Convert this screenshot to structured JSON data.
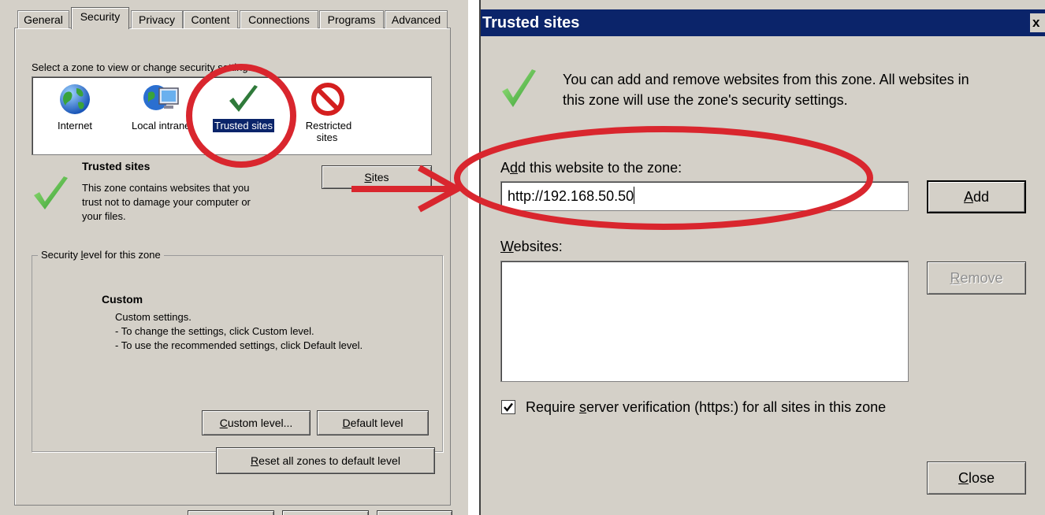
{
  "left_dialog": {
    "tabs": [
      {
        "label": "General"
      },
      {
        "label": "Security"
      },
      {
        "label": "Privacy"
      },
      {
        "label": "Content"
      },
      {
        "label": "Connections"
      },
      {
        "label": "Programs"
      },
      {
        "label": "Advanced"
      }
    ],
    "active_tab": "Security",
    "zone_prompt": "Select a zone to view or change security settings.",
    "zones": [
      {
        "label": "Internet",
        "icon": "globe-icon"
      },
      {
        "label": "Local intranet",
        "icon": "intranet-icon"
      },
      {
        "label": "Trusted sites",
        "icon": "checkmark-icon"
      },
      {
        "label": "Restricted sites",
        "label_line1": "Restricted",
        "label_line2": "sites",
        "icon": "restricted-icon"
      }
    ],
    "selected_zone": "Trusted sites",
    "zone_info": {
      "title": "Trusted sites",
      "line1": "This zone contains websites that you",
      "line2": "trust not to damage your computer or",
      "line3": "your files."
    },
    "sites_button": {
      "pre": "",
      "accel": "S",
      "post": "ites"
    },
    "security_level": {
      "legend_pre": "Security ",
      "legend_accel": "l",
      "legend_post": "evel for this zone",
      "level_name": "Custom",
      "line1": "Custom settings.",
      "line2": "- To change the settings, click Custom level.",
      "line3": "- To use the recommended settings, click Default level."
    },
    "custom_level_button": {
      "accel": "C",
      "post": "ustom level..."
    },
    "default_level_button": {
      "accel": "D",
      "post": "efault level"
    },
    "reset_button": {
      "accel": "R",
      "post": "eset all zones to default level"
    }
  },
  "right_dialog": {
    "title": "Trusted sites",
    "close_glyph": "x",
    "description_line1": "You can add and remove websites from this zone. All websites in",
    "description_line2": "this zone will use the zone's security settings.",
    "add_label": {
      "pre": "A",
      "accel": "d",
      "post": "d this website to the zone:"
    },
    "url_value": "http://192.168.50.50",
    "add_button": {
      "accel": "A",
      "post": "dd"
    },
    "websites_label": {
      "accel": "W",
      "post": "ebsites:"
    },
    "remove_button": {
      "accel": "R",
      "post": "emove"
    },
    "require_https": {
      "checked": true,
      "pre": "Require ",
      "accel": "s",
      "post": "erver verification (https:) for all sites in this zone"
    },
    "close_button": {
      "accel": "C",
      "post": "lose"
    }
  },
  "annotation_colors": {
    "highlight": "#d9262e"
  }
}
